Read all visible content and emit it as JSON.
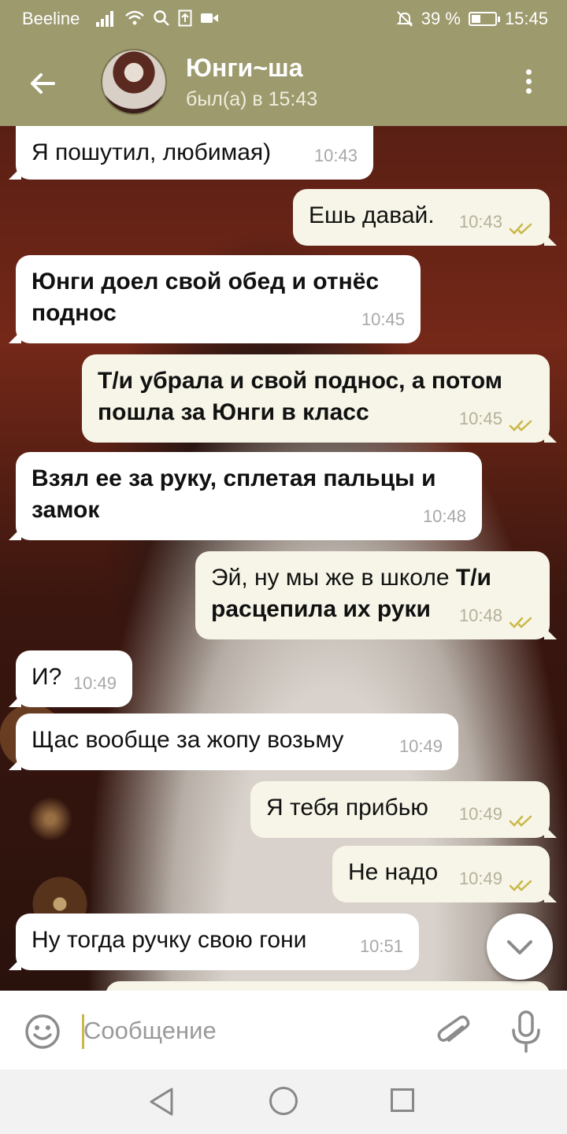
{
  "status_bar": {
    "carrier": "Beeline",
    "battery_percent": "39 %",
    "battery_level": 0.39,
    "time": "15:45",
    "icons": [
      "signal-icon",
      "wifi-icon",
      "search-icon",
      "upload-icon",
      "video-icon",
      "mute-icon",
      "battery-icon"
    ]
  },
  "header": {
    "name": "Юнги~ша",
    "status": "был(а) в 15:43",
    "icons": [
      "back-arrow-icon",
      "avatar",
      "more-vert-icon"
    ]
  },
  "messages": [
    {
      "dir": "in",
      "bold": false,
      "text": "Я пошутил, любимая)",
      "time": "10:43"
    },
    {
      "dir": "out",
      "bold": false,
      "text": "Ешь давай.",
      "time": "10:43",
      "read": true
    },
    {
      "dir": "in",
      "bold": true,
      "text": "Юнги доел свой обед и отнёс поднос",
      "time": "10:45"
    },
    {
      "dir": "out",
      "bold": true,
      "text": "Т/и убрала и свой поднос, а потом пошла за Юнги в класс",
      "time": "10:45",
      "read": true
    },
    {
      "dir": "in",
      "bold": true,
      "text": "Взял ее за руку, сплетая пальцы и замок",
      "time": "10:48"
    },
    {
      "dir": "out",
      "bold": false,
      "text": "Эй, ну мы же в школе",
      "text_bold": "Т/и расцепила их руки",
      "time": "10:48",
      "read": true
    },
    {
      "dir": "in",
      "bold": false,
      "text": "И?",
      "time": "10:49"
    },
    {
      "dir": "in",
      "bold": false,
      "text": "Щас вообще за жопу возьму",
      "time": "10:49"
    },
    {
      "dir": "out",
      "bold": false,
      "text": "Я тебя прибью",
      "time": "10:49",
      "read": true
    },
    {
      "dir": "out",
      "bold": false,
      "text": "Не надо",
      "time": "10:49",
      "read": true
    },
    {
      "dir": "in",
      "bold": false,
      "text": "Ну тогда ручку свою гони",
      "time": "10:51"
    }
  ],
  "composer": {
    "placeholder": "Сообщение",
    "icons": [
      "emoji-icon",
      "attach-icon",
      "mic-icon"
    ]
  },
  "colors": {
    "header_bg": "#9d9a6e",
    "incoming_bubble": "#ffffff",
    "outgoing_bubble": "#f7f5e7",
    "read_check": "#c9b84a"
  }
}
